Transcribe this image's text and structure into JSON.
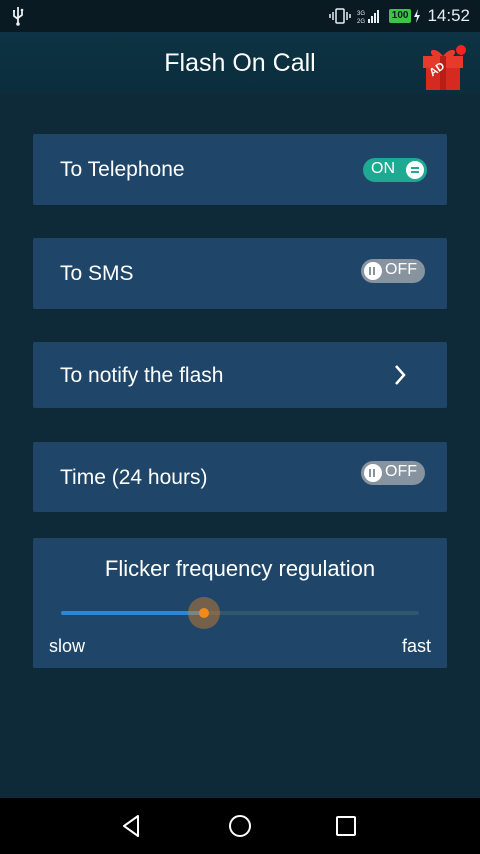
{
  "status_bar": {
    "time": "14:52",
    "battery_level": "100",
    "icons": [
      "usb-icon",
      "vibrate-icon",
      "signal-icon",
      "battery-icon",
      "charging-icon"
    ]
  },
  "header": {
    "title": "Flash On Call",
    "ad_label": "AD"
  },
  "settings": {
    "telephone": {
      "label": "To Telephone",
      "state": "ON"
    },
    "sms": {
      "label": "To SMS",
      "state": "OFF"
    },
    "notify": {
      "label": "To notify the flash"
    },
    "time": {
      "label": "Time (24 hours)",
      "state": "OFF"
    }
  },
  "flicker": {
    "title": "Flicker frequency regulation",
    "min_label": "slow",
    "max_label": "fast",
    "value": 0.4
  },
  "nav": {
    "icons": [
      "back-icon",
      "home-icon",
      "recents-icon"
    ]
  },
  "colors": {
    "accent": "#1ea993",
    "card": "#1f4669",
    "background": "#0e2a38",
    "slider_fill": "#2e86d6",
    "slider_thumb": "#f08a1c"
  }
}
